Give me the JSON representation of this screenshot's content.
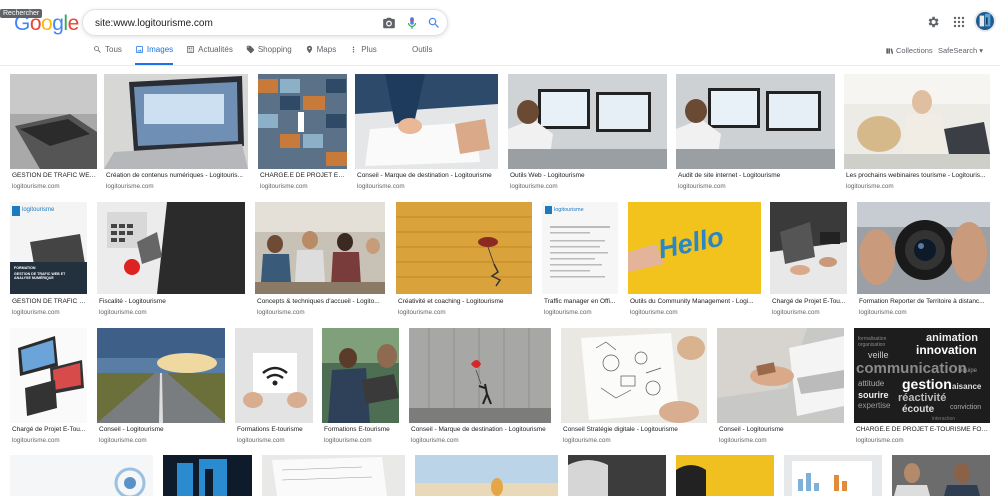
{
  "tooltip": "Rechercher",
  "logo": "Google",
  "search": {
    "query": "site:www.logitourisme.com"
  },
  "tabs": [
    {
      "label": "Tous",
      "icon": "search-icon"
    },
    {
      "label": "Images",
      "icon": "image-icon",
      "active": true
    },
    {
      "label": "Actualités",
      "icon": "news-icon"
    },
    {
      "label": "Shopping",
      "icon": "tag-icon"
    },
    {
      "label": "Maps",
      "icon": "pin-icon"
    },
    {
      "label": "Plus",
      "icon": "more-icon"
    }
  ],
  "tools_label": "Outils",
  "collections_label": "Collections",
  "safesearch_label": "SafeSearch ▾",
  "colors": {
    "accent": "#1a73e8",
    "text": "#202124",
    "muted": "#5f6368"
  },
  "results": {
    "row1": [
      {
        "title": "GESTION DE TRAFIC WEB...",
        "site": "logitourisme.com"
      },
      {
        "title": "Création de contenus numériques - Logitouris...",
        "site": "logitourisme.com"
      },
      {
        "title": "CHARGÉ.E DE PROJET E-T...",
        "site": "logitourisme.com"
      },
      {
        "title": "Conseil - Marque de destination - Logitourisme",
        "site": "logitourisme.com"
      },
      {
        "title": "Outils Web - Logitourisme",
        "site": "logitourisme.com"
      },
      {
        "title": "Audit de site internet - Logitourisme",
        "site": "logitourisme.com"
      },
      {
        "title": "Les prochains webinaires tourisme - Logitouris...",
        "site": "logitourisme.com"
      }
    ],
    "row2": [
      {
        "title": "GESTION DE TRAFIC W...",
        "site": "logitourisme.com",
        "overlay": "logitourisme",
        "poster": "GESTION DE TRAFIC WEB ET ANALYSE NUMÉRIQUE",
        "poster_top": "FORMATION"
      },
      {
        "title": "Fiscalité - Logitourisme",
        "site": "logitourisme.com"
      },
      {
        "title": "Concepts & techniques d'accueil - Logito...",
        "site": "logitourisme.com"
      },
      {
        "title": "Créativité et coaching - Logitourisme",
        "site": "logitourisme.com"
      },
      {
        "title": "Traffic manager en Offi...",
        "site": "logitourisme.com",
        "overlay": "logitourisme"
      },
      {
        "title": "Outils du Community Management - Logi...",
        "site": "logitourisme.com",
        "hello": "Hello"
      },
      {
        "title": "Chargé de Projet E-Tou...",
        "site": "logitourisme.com"
      },
      {
        "title": "Formation Reporter de Territoire à distanc...",
        "site": "logitourisme.com"
      }
    ],
    "row3": [
      {
        "title": "Chargé de Projet E-Tou...",
        "site": "logitourisme.com"
      },
      {
        "title": "Conseil - Logitourisme",
        "site": "logitourisme.com"
      },
      {
        "title": "Formations E-tourisme",
        "site": "logitourisme.com"
      },
      {
        "title": "Formations E-tourisme",
        "site": "logitourisme.com"
      },
      {
        "title": "Conseil - Marque de destination - Logitourisme",
        "site": "logitourisme.com"
      },
      {
        "title": "Conseil Stratégie digitale - Logitourisme",
        "site": "logitourisme.com"
      },
      {
        "title": "Conseil - Logitourisme",
        "site": "logitourisme.com"
      },
      {
        "title": "CHARGÉ.E DE PROJET E-TOURISME FORM...",
        "site": "logitourisme.com",
        "words": [
          "animation",
          "innovation",
          "veille",
          "communication",
          "attitude",
          "gestion",
          "aisance",
          "sourire",
          "réactivité",
          "expertise",
          "écoute",
          "conviction",
          "formalisation",
          "organisation",
          "équipe",
          "interaction"
        ]
      }
    ]
  }
}
